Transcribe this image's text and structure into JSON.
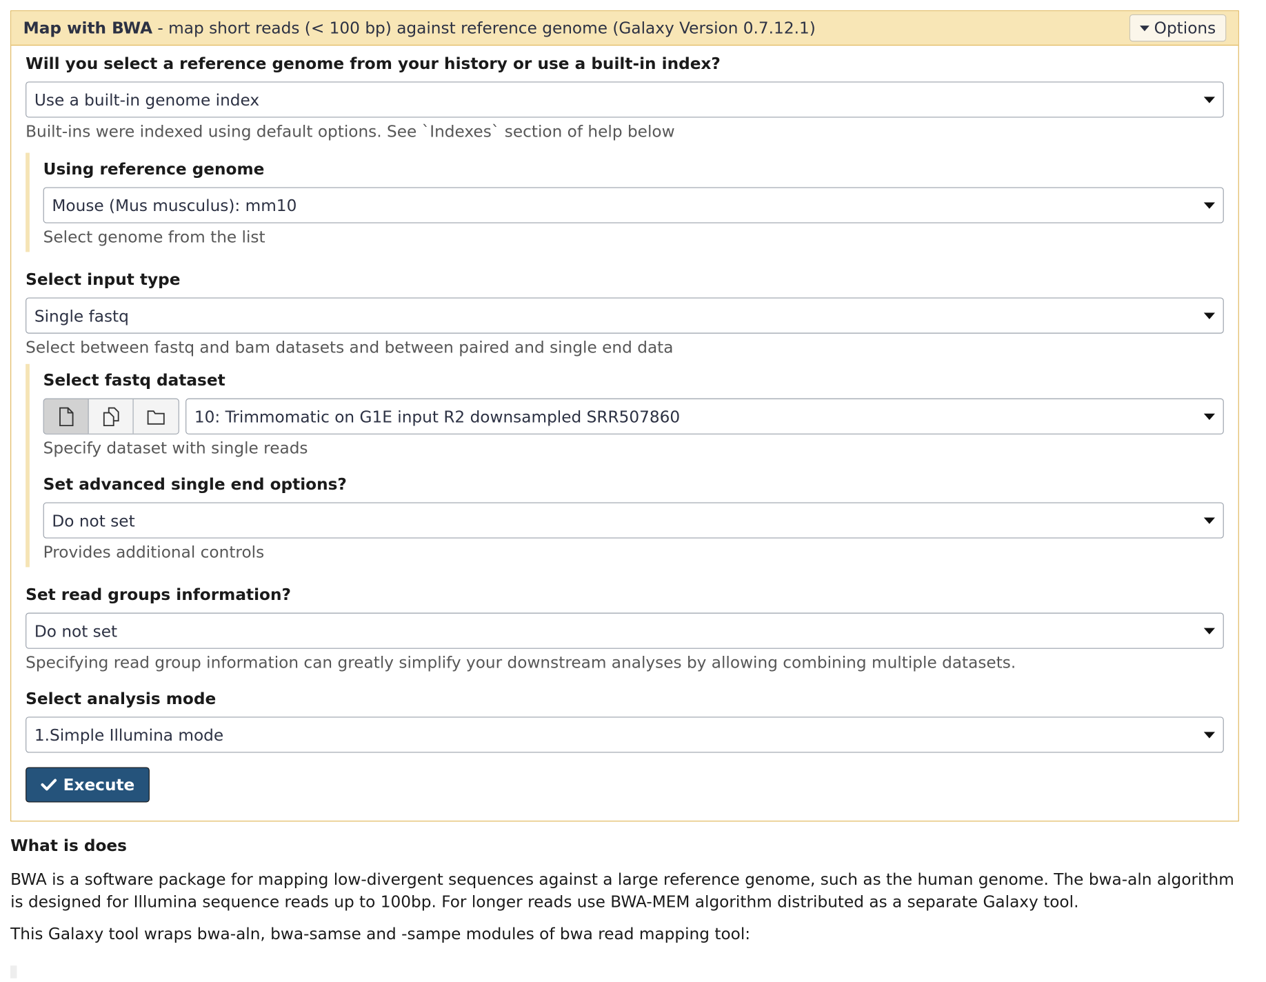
{
  "tool": {
    "name": "Map with BWA",
    "description": "- map short reads (< 100 bp) against reference genome (Galaxy Version 0.7.12.1)",
    "options_label": "Options"
  },
  "fields": {
    "reference_source": {
      "label": "Will you select a reference genome from your history or use a built-in index?",
      "value": "Use a built-in genome index",
      "help": "Built-ins were indexed using default options. See `Indexes` section of help below"
    },
    "reference_genome": {
      "label": "Using reference genome",
      "value": "Mouse (Mus musculus): mm10",
      "help": "Select genome from the list"
    },
    "input_type": {
      "label": "Select input type",
      "value": "Single fastq",
      "help": "Select between fastq and bam datasets and between paired and single end data"
    },
    "fastq_dataset": {
      "label": "Select fastq dataset",
      "value": "10: Trimmomatic on G1E input R2 downsampled SRR507860",
      "help": "Specify dataset with single reads"
    },
    "advanced_se": {
      "label": "Set advanced single end options?",
      "value": "Do not set",
      "help": "Provides additional controls"
    },
    "read_groups": {
      "label": "Set read groups information?",
      "value": "Do not set",
      "help": "Specifying read group information can greatly simplify your downstream analyses by allowing combining multiple datasets."
    },
    "analysis_mode": {
      "label": "Select analysis mode",
      "value": "1.Simple Illumina mode"
    }
  },
  "execute_label": "Execute",
  "help_section": {
    "heading": "What is does",
    "p1": "BWA is a software package for mapping low-divergent sequences against a large reference genome, such as the human genome. The bwa-aln algorithm is designed for Illumina sequence reads up to 100bp. For longer reads use BWA-MEM algorithm distributed as a separate Galaxy tool.",
    "p2": "This Galaxy tool wraps bwa-aln, bwa-samse and -sampe modules of bwa read mapping tool:"
  }
}
